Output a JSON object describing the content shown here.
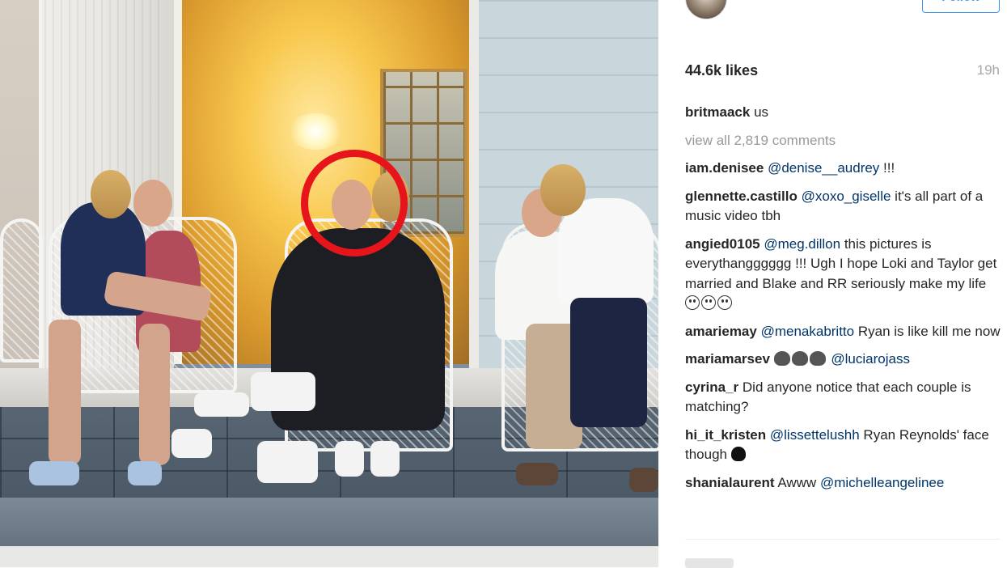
{
  "post": {
    "header_username": "britmaack",
    "follow_label": "Follow",
    "likes": "44.6k likes",
    "time_ago": "19h",
    "caption": {
      "user": "britmaack",
      "text": "us"
    },
    "view_all_comments": "view all 2,819 comments"
  },
  "comments": [
    {
      "user": "iam.denisee",
      "mention": "@denise__audrey",
      "text": " !!!"
    },
    {
      "user": "glennette.castillo",
      "mention": "@xoxo_giselle",
      "text": " it's all part of a music video tbh"
    },
    {
      "user": "angied0105",
      "mention": "@meg.dillon",
      "text": " this pictures is everythangggggg !!! Ugh I hope Loki and Taylor get married and Blake and RR seriously make my life"
    },
    {
      "user": "amariemay",
      "mention": "@menakabritto",
      "text": " Ryan is like kill me now"
    },
    {
      "user": "mariamarsev",
      "mention": "@luciarojass",
      "text": ""
    },
    {
      "user": "cyrina_r",
      "mention": "",
      "text": "Did anyone notice that each couple is matching?"
    },
    {
      "user": "hi_it_kristen",
      "mention": "@lissettelushh",
      "text": " Ryan Reynolds' face though"
    },
    {
      "user": "shanialaurent",
      "mention": "",
      "text": "Awww",
      "mention_after": "@michelleangelinee"
    }
  ],
  "colors": {
    "highlight_ring": "#e8141c",
    "mention": "#003569",
    "follow": "#3897f0"
  },
  "icons": [
    "emoji-face",
    "emoji-monkey",
    "emoji-skull"
  ]
}
